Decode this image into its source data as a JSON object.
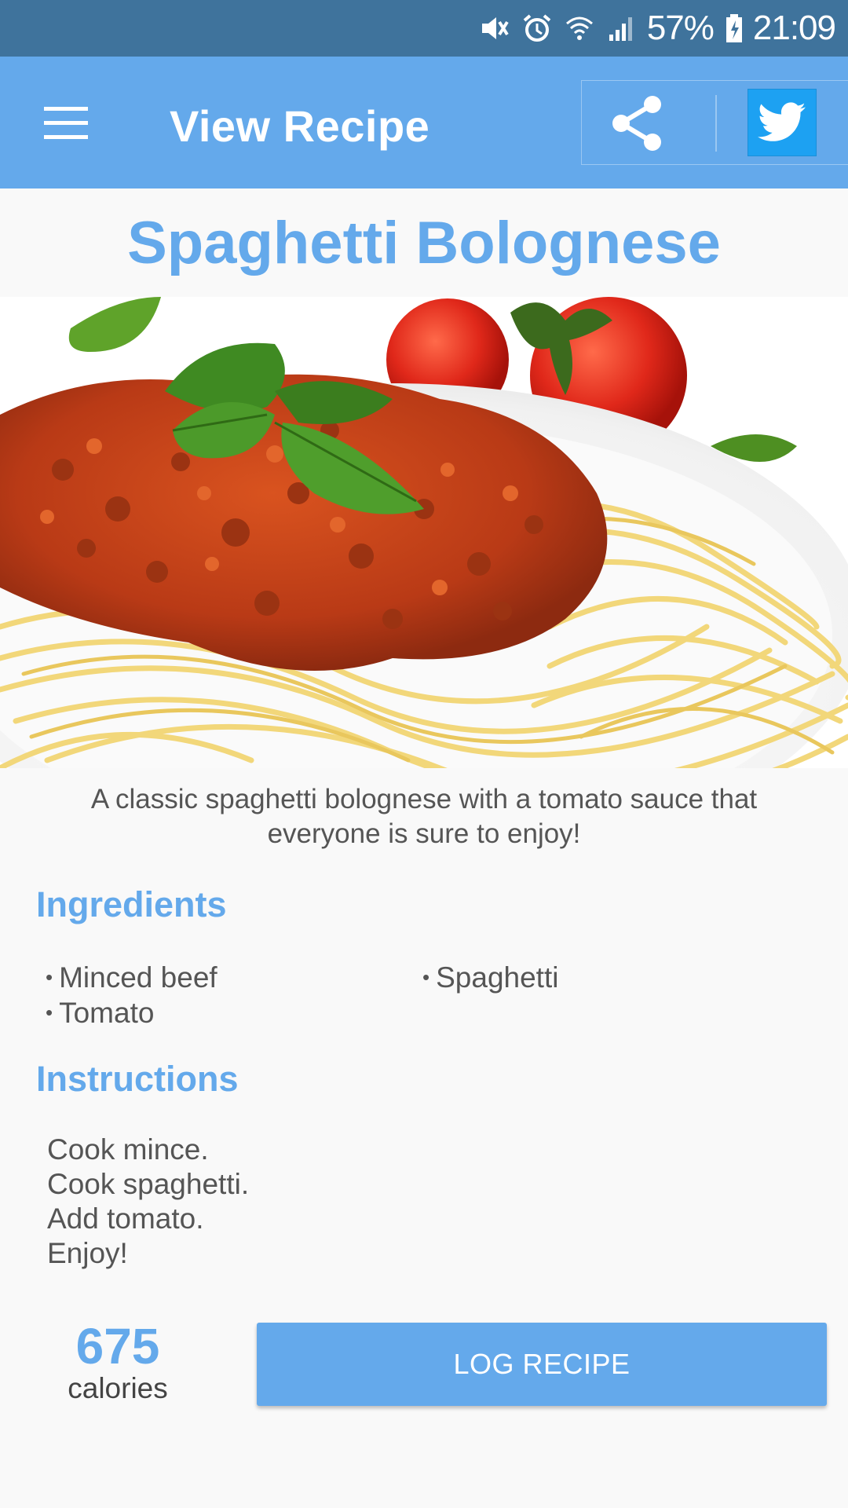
{
  "status_bar": {
    "battery": "57%",
    "time": "21:09"
  },
  "app_bar": {
    "title": "View Recipe"
  },
  "recipe": {
    "title": "Spaghetti Bolognese",
    "description": "A classic spaghetti bolognese with a tomato sauce that everyone is sure to enjoy!",
    "ingredients_heading": "Ingredients",
    "ingredients": [
      "Minced beef",
      "Spaghetti",
      "Tomato"
    ],
    "instructions_heading": "Instructions",
    "instructions": [
      "Cook mince.",
      "Cook spaghetti.",
      "Add tomato.",
      "Enjoy!"
    ],
    "calories_value": "675",
    "calories_label": "calories",
    "log_button": "LOG RECIPE"
  },
  "icons": {
    "menu": "hamburger-menu-icon",
    "share": "share-icon",
    "twitter": "twitter-icon"
  },
  "colors": {
    "status_bar": "#3f739c",
    "primary": "#64a9eb",
    "twitter": "#1da1f2",
    "text": "#555555",
    "background": "#f9f9f9"
  }
}
